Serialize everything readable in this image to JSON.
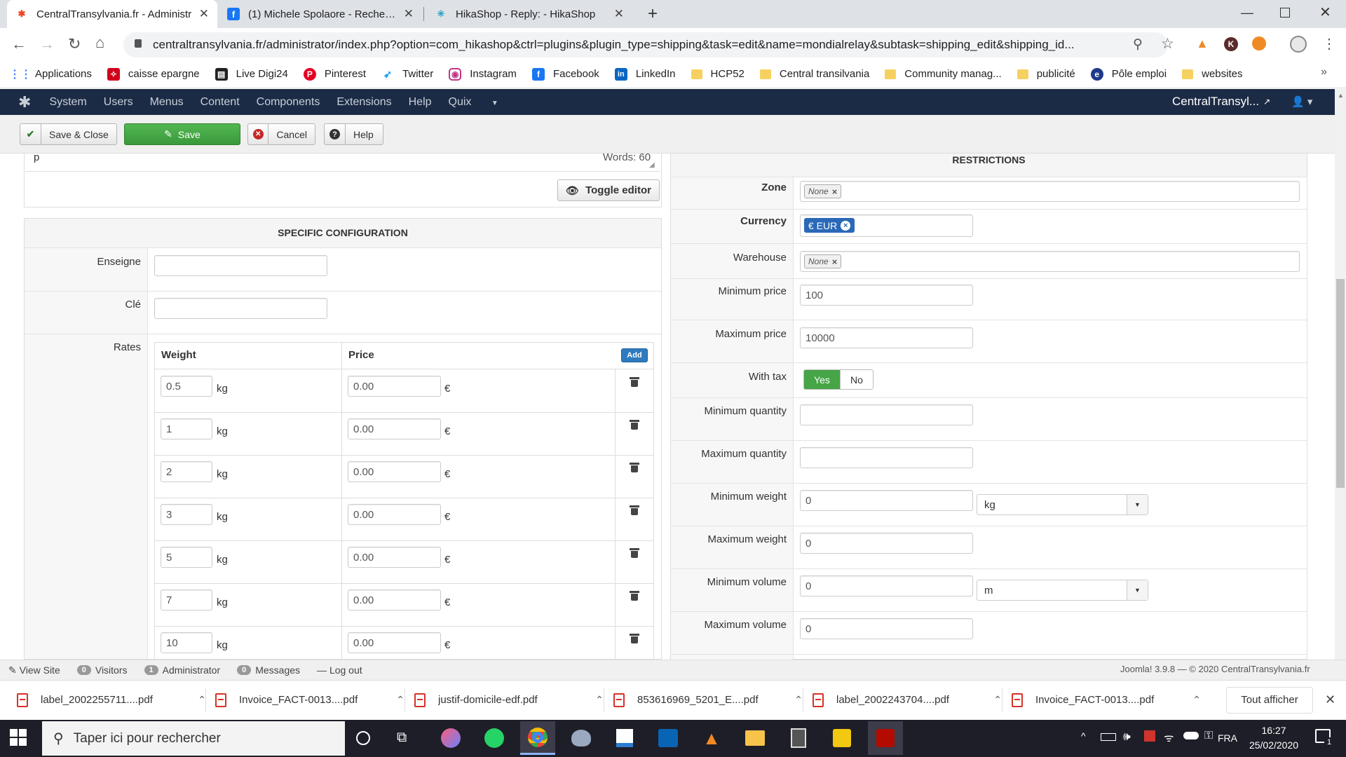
{
  "browser": {
    "tabs": [
      {
        "title": "CentralTransylvania.fr - Administr",
        "active": true
      },
      {
        "title": "(1) Michele Spolaore - Recherche",
        "active": false
      },
      {
        "title": "HikaShop - Reply: - HikaShop",
        "active": false
      }
    ],
    "url": "centraltransylvania.fr/administrator/index.php?option=com_hikashop&ctrl=plugins&plugin_type=shipping&task=edit&name=mondialrelay&subtask=shipping_edit&shipping_id...",
    "bookmarks": [
      "Applications",
      "caisse epargne",
      "Live Digi24",
      "Pinterest",
      "Twitter",
      "Instagram",
      "Facebook",
      "LinkedIn",
      "HCP52",
      "Central transilvania",
      "Community manag...",
      "publicité",
      "Pôle emploi",
      "websites"
    ],
    "profile_initial": "K"
  },
  "joomla_menu": {
    "items": [
      "System",
      "Users",
      "Menus",
      "Content",
      "Components",
      "Extensions",
      "Help",
      "Quix"
    ],
    "site_name": "CentralTransyl..."
  },
  "toolbar": {
    "save_close": "Save & Close",
    "save": "Save",
    "cancel": "Cancel",
    "help": "Help"
  },
  "editor": {
    "path": "p",
    "words": "Words: 60",
    "toggle": "Toggle editor"
  },
  "specific": {
    "title": "SPECIFIC CONFIGURATION",
    "enseigne_label": "Enseigne",
    "enseigne_value": "",
    "cle_label": "Clé",
    "cle_value": "",
    "rates_label": "Rates",
    "weight_header": "Weight",
    "price_header": "Price",
    "add_label": "Add",
    "weight_unit": "kg",
    "currency_symbol": "€",
    "rows": [
      {
        "weight": "0.5",
        "price": "0.00"
      },
      {
        "weight": "1",
        "price": "0.00"
      },
      {
        "weight": "2",
        "price": "0.00"
      },
      {
        "weight": "3",
        "price": "0.00"
      },
      {
        "weight": "5",
        "price": "0.00"
      },
      {
        "weight": "7",
        "price": "0.00"
      },
      {
        "weight": "10",
        "price": "0.00"
      }
    ]
  },
  "restrictions": {
    "title": "RESTRICTIONS",
    "zone_label": "Zone",
    "zone_tag": "None",
    "currency_label": "Currency",
    "currency_tag": "€ EUR",
    "warehouse_label": "Warehouse",
    "warehouse_tag": "None",
    "min_price_label": "Minimum price",
    "min_price": "100",
    "max_price_label": "Maximum price",
    "max_price": "10000",
    "with_tax_label": "With tax",
    "yes": "Yes",
    "no": "No",
    "min_qty_label": "Minimum quantity",
    "min_qty": "",
    "max_qty_label": "Maximum quantity",
    "max_qty": "",
    "min_weight_label": "Minimum weight",
    "min_weight": "0",
    "weight_unit": "kg",
    "max_weight_label": "Maximum weight",
    "max_weight": "0",
    "min_volume_label": "Minimum volume",
    "min_volume": "0",
    "volume_unit": "m",
    "max_volume_label": "Maximum volume",
    "max_volume": "0"
  },
  "statusbar": {
    "view_site": "View Site",
    "visitors_count": "0",
    "visitors": "Visitors",
    "admin_count": "1",
    "administrator": "Administrator",
    "messages_count": "0",
    "messages": "Messages",
    "logout": "Log out",
    "version": "Joomla! 3.9.8",
    "copyright": "© 2020 CentralTransylvania.fr"
  },
  "downloads": {
    "files": [
      "label_2002255711....pdf",
      "Invoice_FACT-0013....pdf",
      "justif-domicile-edf.pdf",
      "853616969_5201_E....pdf",
      "label_2002243704....pdf",
      "Invoice_FACT-0013....pdf"
    ],
    "show_all": "Tout afficher"
  },
  "taskbar": {
    "search_placeholder": "Taper ici pour rechercher",
    "lang": "FRA",
    "time": "16:27",
    "date": "25/02/2020",
    "notif_count": "1"
  },
  "colors": {
    "joomla_nav": "#1c2b45",
    "save_green": "#46a546",
    "tag_blue": "#2a69b8",
    "add_blue": "#2f7bbf"
  }
}
